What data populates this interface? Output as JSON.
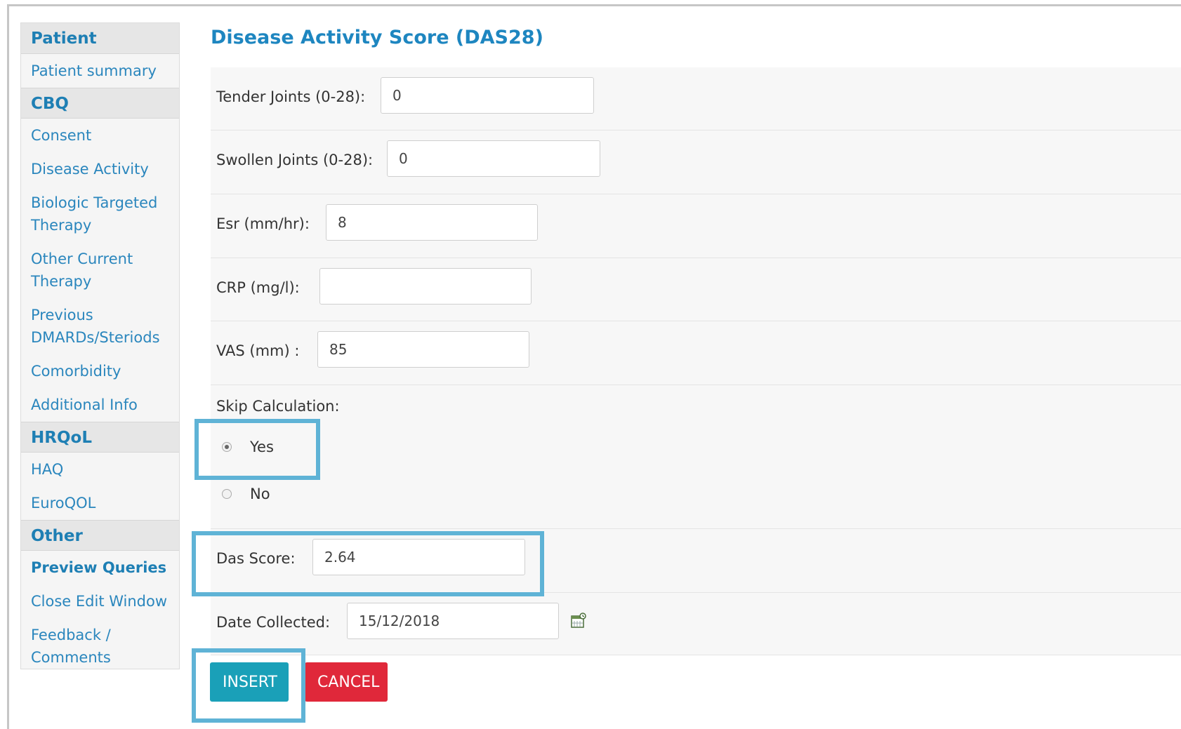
{
  "sidebar": {
    "sections": [
      {
        "header": "Patient",
        "items": [
          {
            "label": "Patient summary"
          }
        ]
      },
      {
        "header": "CBQ",
        "items": [
          {
            "label": "Consent"
          },
          {
            "label": "Disease Activity"
          },
          {
            "label": "Biologic Targeted Therapy"
          },
          {
            "label": "Other Current Therapy"
          },
          {
            "label": "Previous DMARDs/Steriods"
          },
          {
            "label": "Comorbidity"
          },
          {
            "label": "Additional Info"
          }
        ]
      },
      {
        "header": "HRQoL",
        "items": [
          {
            "label": "HAQ"
          },
          {
            "label": "EuroQOL"
          }
        ]
      },
      {
        "header": "Other",
        "items": [
          {
            "label": "Preview Queries"
          },
          {
            "label": "Close Edit Window"
          },
          {
            "label": "Feedback / Comments"
          }
        ]
      }
    ]
  },
  "form": {
    "title": "Disease Activity Score (DAS28)",
    "tender_joints": {
      "label": "Tender Joints (0-28):",
      "value": "0"
    },
    "swollen_joints": {
      "label": "Swollen Joints (0-28):",
      "value": "0"
    },
    "esr": {
      "label": "Esr (mm/hr):",
      "value": "8"
    },
    "crp": {
      "label": "CRP (mg/l):",
      "value": ""
    },
    "vas": {
      "label": "VAS (mm) :",
      "value": "85"
    },
    "skip_calculation": {
      "label": "Skip Calculation:",
      "options": [
        {
          "label": "Yes",
          "selected": true
        },
        {
          "label": "No",
          "selected": false
        }
      ]
    },
    "das_score": {
      "label": "Das Score:",
      "value": "2.64"
    },
    "date_collected": {
      "label": "Date Collected:",
      "value": "15/12/2018"
    },
    "insert_label": "INSERT",
    "cancel_label": "CANCEL"
  },
  "colors": {
    "accent": "#1e86c0",
    "highlight": "#5fb3d6",
    "insert": "#1aa0b8",
    "cancel": "#e0283a"
  }
}
